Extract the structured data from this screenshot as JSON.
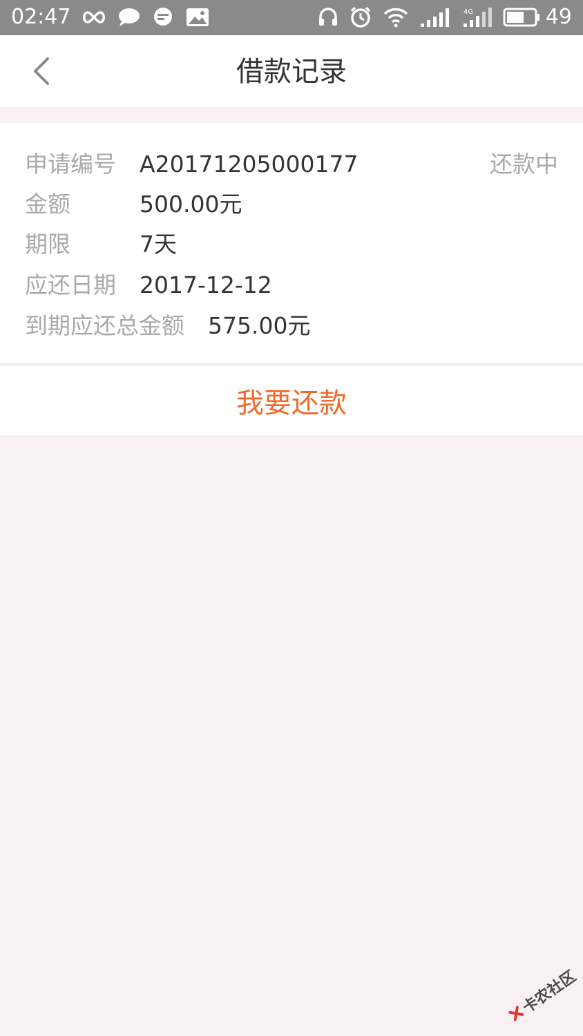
{
  "status_bar": {
    "time": "02:47",
    "battery_percent": "49",
    "network_label": "4G",
    "icons": [
      "infinity-icon",
      "chat-bubble-icon",
      "message-icon",
      "image-icon",
      "headset-icon",
      "alarm-icon",
      "wifi-icon",
      "signal-icon",
      "signal-4g-icon",
      "battery-icon"
    ]
  },
  "nav": {
    "title": "借款记录",
    "back_icon": "chevron-left-icon"
  },
  "record": {
    "status": "还款中",
    "rows": [
      {
        "label": "申请编号",
        "value": "A20171205000177"
      },
      {
        "label": "金额",
        "value": "500.00元"
      },
      {
        "label": "期限",
        "value": "7天"
      },
      {
        "label": "应还日期",
        "value": "2017-12-12"
      },
      {
        "label": "到期应还总金额",
        "value": "575.00元"
      }
    ]
  },
  "action": {
    "repay_label": "我要还款"
  },
  "watermark": {
    "text": "卡农社区"
  },
  "colors": {
    "status_bar": "#8a8a8a",
    "accent": "#ef6a2c",
    "page_background": "#f8f0f2",
    "label_text": "#a9a9a9",
    "value_text": "#333333"
  }
}
